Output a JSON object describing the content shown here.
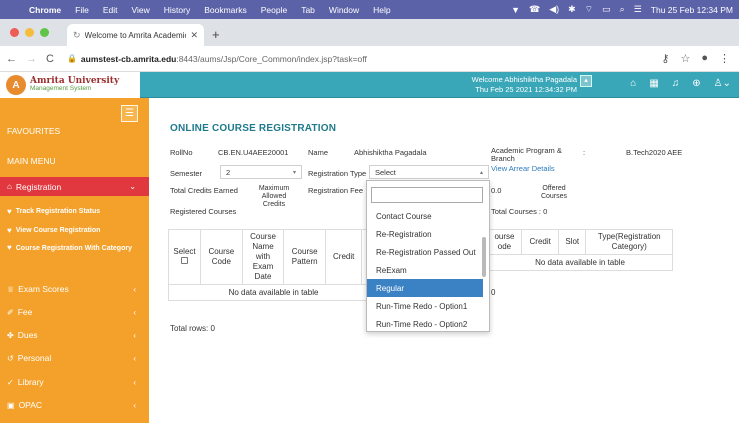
{
  "menubar": {
    "app": "Chrome",
    "items": [
      "File",
      "Edit",
      "View",
      "History",
      "Bookmarks",
      "People",
      "Tab",
      "Window",
      "Help"
    ],
    "clock": "Thu 25 Feb  12:34 PM"
  },
  "browser": {
    "tab_title": "Welcome to Amrita Academic",
    "url_host": "aumstest-cb.amrita.edu",
    "url_path": ":8443/aums/Jsp/Core_Common/index.jsp?task=off"
  },
  "header": {
    "logo_line1": "Amrita University",
    "logo_line2": "Management System",
    "welcome_line1": "Welcome Abhishiktha Pagadala",
    "welcome_line2": "Thu Feb 25 2021 12:34:32 PM"
  },
  "sidebar": {
    "favourites": "FAVOURITES",
    "main_menu": "MAIN MENU",
    "registration": "Registration",
    "track_status": "Track Registration Status",
    "view_course_reg": "View Course Registration",
    "course_reg_category": "Course Registration With Category",
    "exam_scores": "Exam Scores",
    "fee": "Fee",
    "dues": "Dues",
    "personal": "Personal",
    "library": "Library",
    "opac": "OPAC"
  },
  "form": {
    "title": "ONLINE COURSE REGISTRATION",
    "rollno_label": "RollNo",
    "rollno_value": "CB.EN.U4AEE20001",
    "name_label": "Name",
    "name_value": "Abhishiktha Pagadala",
    "program_label_1": "Academic Program &",
    "program_label_2": "Branch",
    "colon": ":",
    "program_value": "B.Tech2020 AEE",
    "view_arrear": "View Arrear Details",
    "semester_label": "Semester",
    "semester_value": "2",
    "reg_type_label": "Registration Type",
    "reg_type_value": "Select",
    "total_credits_label": "Total Credits Earned",
    "max_credits_1": "Maximum",
    "max_credits_2": "Allowed",
    "max_credits_3": "Credits",
    "reg_fee_label": "Registration Fee",
    "fee_value": "0.0",
    "offered_1": "Offered",
    "offered_2": "Courses",
    "registered_label": "Registered Courses",
    "total_courses": "Total Courses : 0",
    "total_rows": "Total rows: 0",
    "right_count": "0"
  },
  "left_table": {
    "h_select": "Select",
    "h_code_1": "Course",
    "h_code_2": "Code",
    "h_name_1": "Course",
    "h_name_2": "Name",
    "h_name_3": "with",
    "h_name_4": "Exam",
    "h_name_5": "Date",
    "h_pattern_1": "Course",
    "h_pattern_2": "Pattern",
    "h_credit": "Credit",
    "h_s": "S",
    "empty": "No data available in table"
  },
  "right_table": {
    "h_code_1": "ourse",
    "h_code_2": "ode",
    "h_credit": "Credit",
    "h_slot": "Slot",
    "h_type_1": "Type(Registration",
    "h_type_2": "Category)",
    "empty": "No data available in table"
  },
  "dropdown": {
    "search_value": "",
    "options": [
      "Contact Course",
      "Re-Registration",
      "Re-Registration Passed Out",
      "ReExam",
      "Regular",
      "Run-Time Redo - Option1",
      "Run-Time Redo - Option2"
    ],
    "highlighted": "Regular"
  },
  "colors": {
    "menubar": "#5b62a8",
    "header": "#3aa7b8",
    "sidebar": "#f4a12b",
    "active_item": "#e0383e",
    "title": "#1f7a8c",
    "highlight": "#3b82c4"
  }
}
